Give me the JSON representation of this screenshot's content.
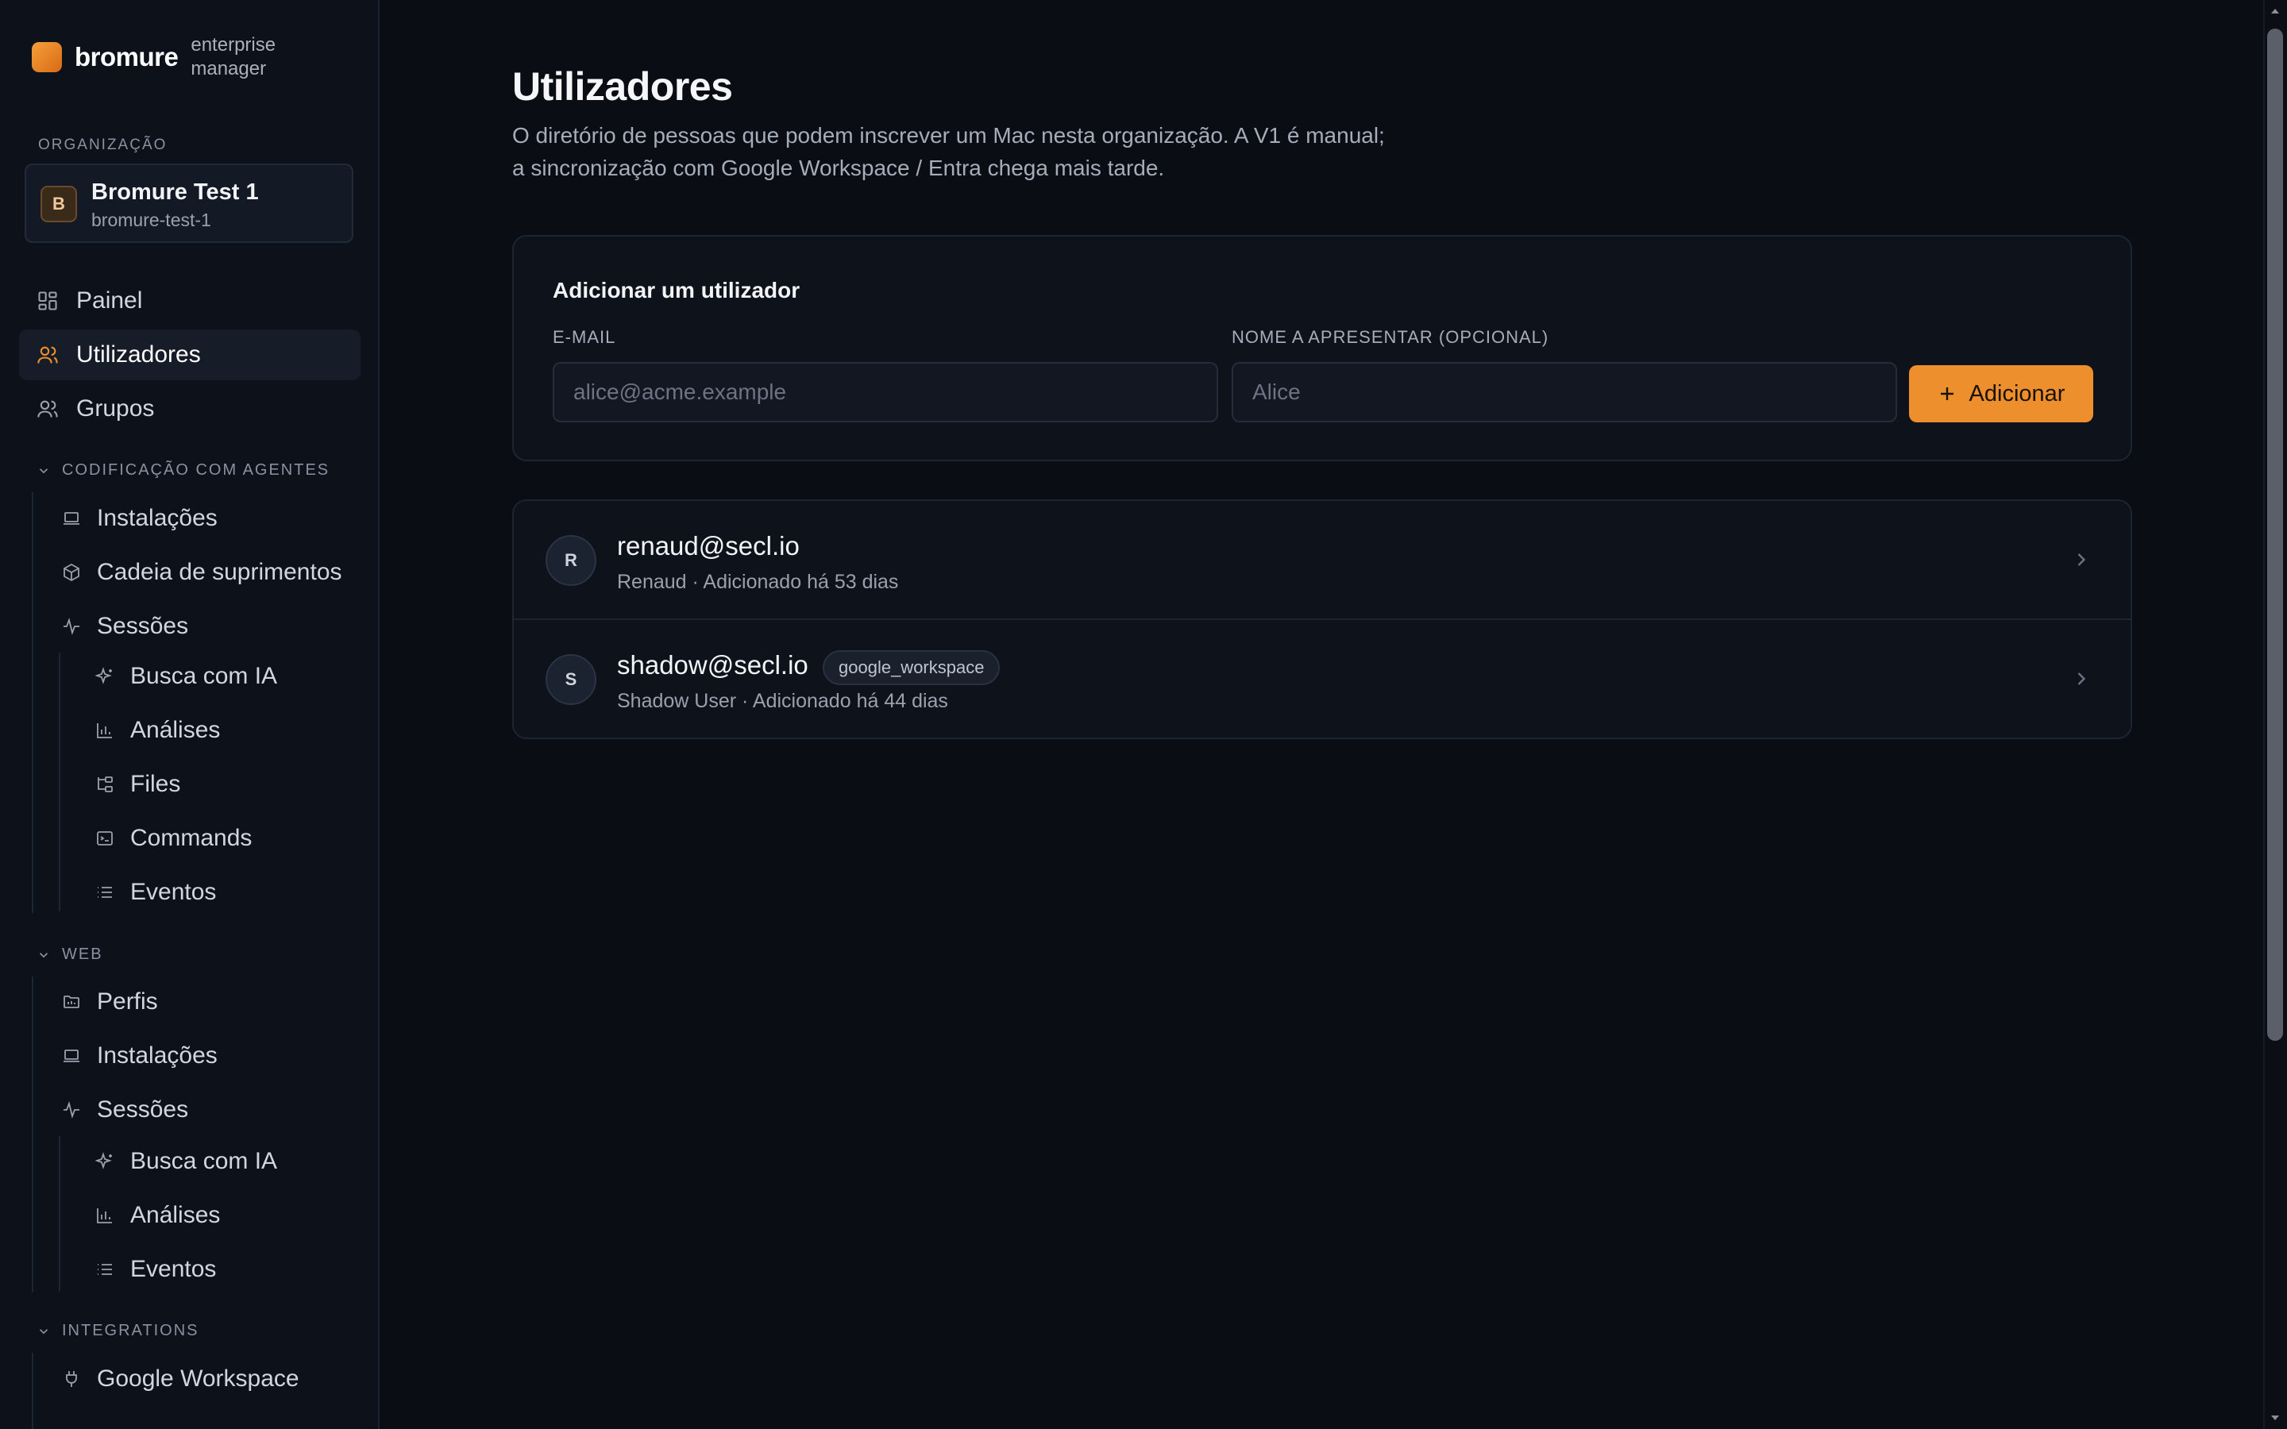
{
  "brand": {
    "name": "bromure",
    "subtitle": "enterprise manager"
  },
  "organization": {
    "section_label": "ORGANIZAÇÃO",
    "avatar_letter": "B",
    "name": "Bromure Test 1",
    "slug": "bromure-test-1"
  },
  "nav": {
    "painel": "Painel",
    "utilizadores": "Utilizadores",
    "grupos": "Grupos"
  },
  "groups": {
    "agents": {
      "label": "CODIFICAÇÃO COM AGENTES",
      "instalacoes": "Instalações",
      "cadeia": "Cadeia de suprimentos",
      "sessoes": "Sessões",
      "busca": "Busca com IA",
      "analises": "Análises",
      "files": "Files",
      "commands": "Commands",
      "eventos": "Eventos"
    },
    "web": {
      "label": "WEB",
      "perfis": "Perfis",
      "instalacoes": "Instalações",
      "sessoes": "Sessões",
      "busca": "Busca com IA",
      "analises": "Análises",
      "eventos": "Eventos"
    },
    "integrations": {
      "label": "INTEGRATIONS",
      "google": "Google Workspace"
    }
  },
  "page": {
    "title": "Utilizadores",
    "description": "O diretório de pessoas que podem inscrever um Mac nesta organização. A V1 é manual; a sincronização com Google Workspace / Entra chega mais tarde."
  },
  "add_form": {
    "title": "Adicionar um utilizador",
    "email_label": "E-MAIL",
    "email_placeholder": "alice@acme.example",
    "name_label": "NOME A APRESENTAR (OPCIONAL)",
    "name_placeholder": "Alice",
    "button_label": "Adicionar"
  },
  "users": [
    {
      "avatar": "R",
      "email": "renaud@secl.io",
      "meta": "Renaud · Adicionado há 53 dias",
      "badge": ""
    },
    {
      "avatar": "S",
      "email": "shadow@secl.io",
      "meta": "Shadow User · Adicionado há 44 dias",
      "badge": "google_workspace"
    }
  ],
  "colors": {
    "accent": "#ec8f2c",
    "background": "#0a0d14",
    "sidebar": "#0d1119"
  }
}
